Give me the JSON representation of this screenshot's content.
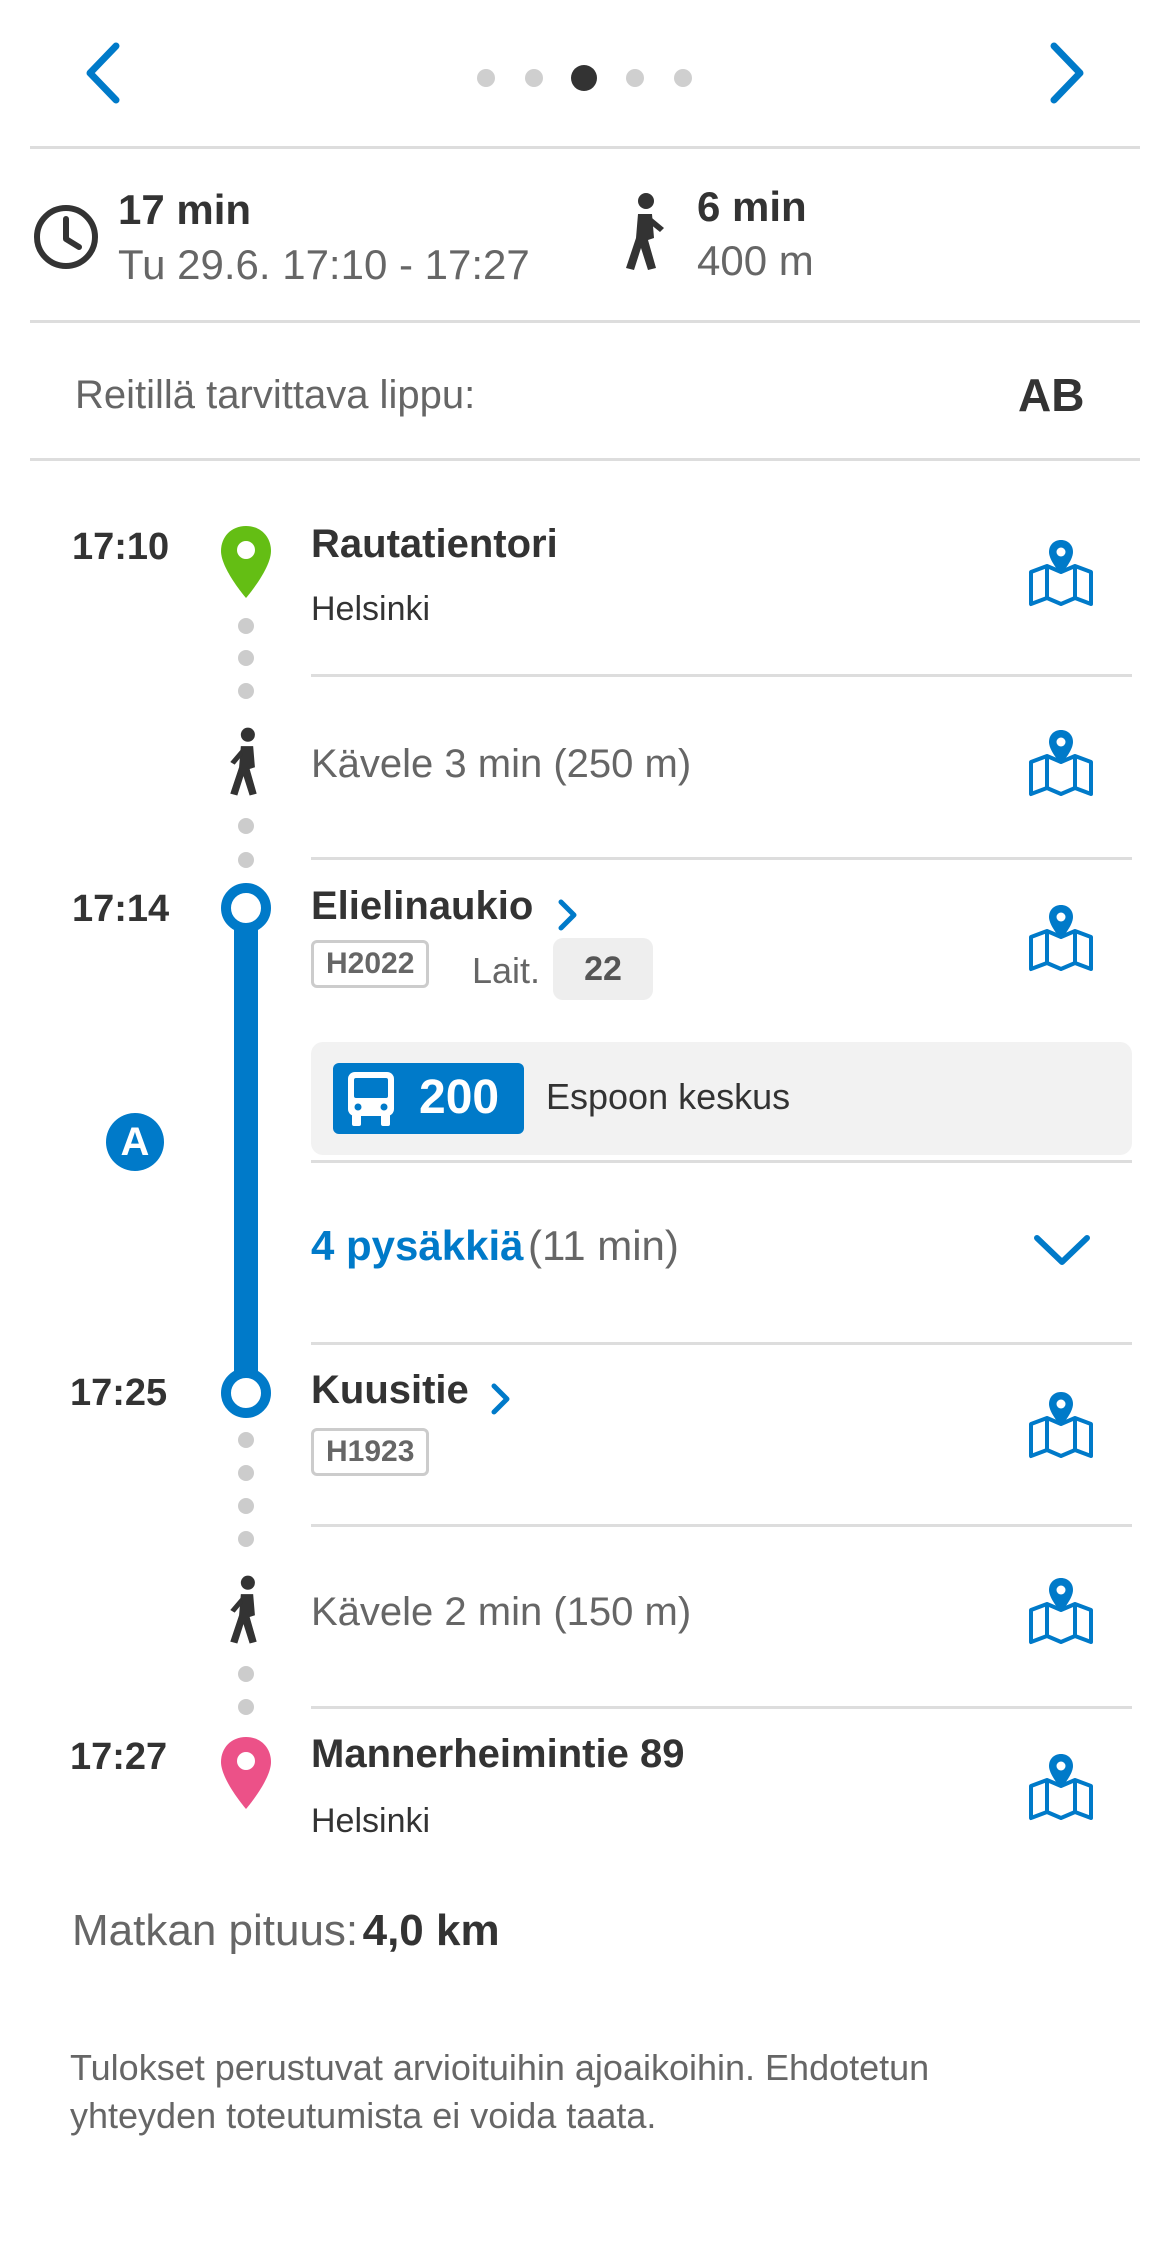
{
  "header": {
    "pager": {
      "count": 5,
      "active_index": 2
    }
  },
  "summary": {
    "duration": "17 min",
    "date_time": "Tu 29.6. 17:10 - 17:27",
    "walk_duration": "6 min",
    "walk_distance": "400 m"
  },
  "ticket": {
    "label": "Reitillä tarvittava lippu:",
    "zones": "AB"
  },
  "itinerary": {
    "origin": {
      "time": "17:10",
      "name": "Rautatientori",
      "city": "Helsinki"
    },
    "walk1": {
      "text": "Kävele 3 min (250 m)"
    },
    "board": {
      "time": "17:14",
      "name": "Elielinaukio",
      "code": "H2022",
      "platform_label": "Lait.",
      "platform": "22"
    },
    "leg": {
      "line": "200",
      "headsign": "Espoon keskus",
      "zone": "A",
      "stops_link": "4 pysäkkiä",
      "stops_duration": "(11 min)"
    },
    "alight": {
      "time": "17:25",
      "name": "Kuusitie",
      "code": "H1923"
    },
    "walk2": {
      "text": "Kävele 2 min (150 m)"
    },
    "destination": {
      "time": "17:27",
      "name": "Mannerheimintie 89",
      "city": "Helsinki"
    }
  },
  "footer": {
    "length_label": "Matkan pituus:",
    "length_value": "4,0 km",
    "disclaimer": "Tulokset perustuvat arvioituihin ajoaikoihin. Ehdotetun yhteyden toteutumista ei voida taata."
  },
  "colors": {
    "accent": "#007ac9",
    "origin_pin": "#64be14",
    "destination_pin": "#ec5188",
    "text": "#333333",
    "muted": "#666666"
  }
}
